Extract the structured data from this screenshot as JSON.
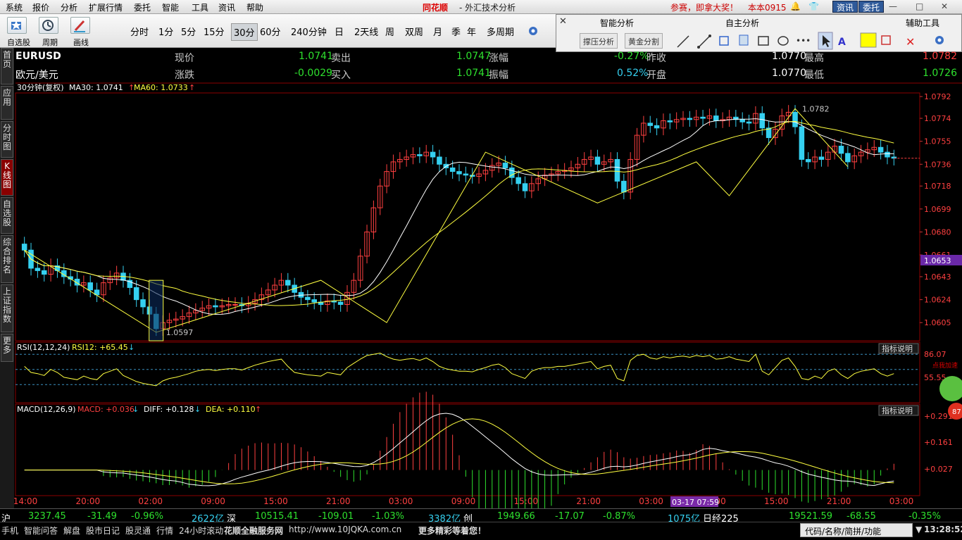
{
  "menu": [
    "系统",
    "报价",
    "分析",
    "扩展行情",
    "委托",
    "智能",
    "工具",
    "资讯",
    "帮助"
  ],
  "brand": {
    "logo": "同花顺",
    "subtitle": "- 外汇技术分析"
  },
  "promo": "参赛，即拿大奖！",
  "user": "本本0915",
  "top_buttons": {
    "news": "资讯",
    "entrust": "委托"
  },
  "toolbar": {
    "watchlist": "自选股",
    "cycle": "周期",
    "drawline": "画线"
  },
  "periods": [
    "分时",
    "1分",
    "5分",
    "15分",
    "30分",
    "60分",
    "240分钟",
    "日",
    "2天线",
    "周",
    "双周",
    "月",
    "季",
    "年",
    "多周期"
  ],
  "active_period": "30分",
  "float_panel": {
    "smart": "智能分析",
    "self": "自主分析",
    "aux": "辅助工具",
    "btn_resist": "撑压分析",
    "btn_golden": "黄金分割"
  },
  "sidebar": [
    {
      "label": "首页",
      "active": false
    },
    {
      "label": "应用",
      "active": false
    },
    {
      "label": "分时图",
      "active": false
    },
    {
      "label": "K线图",
      "active": true
    },
    {
      "label": "自选股",
      "active": false
    },
    {
      "label": "综合排名",
      "active": false
    },
    {
      "label": "上证指数",
      "active": false
    },
    {
      "label": "更多",
      "active": false
    }
  ],
  "quote": {
    "code": "EURUSD",
    "name": "欧元/美元",
    "now_label": "现价",
    "now": "1.0741",
    "sell_label": "卖出",
    "sell": "1.0747",
    "chgpct_label": "涨幅",
    "chgpct": "-0.27%",
    "prev_label": "昨收",
    "prev": "1.0770",
    "high_label": "最高",
    "high": "1.0782",
    "chg_label": "涨跌",
    "chg": "-0.0029",
    "buy_label": "买入",
    "buy": "1.0741",
    "amp_label": "振幅",
    "amp": "0.52%",
    "open_label": "开盘",
    "open": "1.0770",
    "low_label": "最低",
    "low": "1.0726"
  },
  "indicators": {
    "main": "30分钟(复权)",
    "ma30": "MA30: 1.0741",
    "ma60": "MA60: 1.0733",
    "rsi": "RSI(12,12,24)",
    "rsi12": "RSI12: +65.45",
    "macd": "MACD(12,26,9)",
    "macd_val": "MACD: +0.036",
    "diff": "DIFF: +0.128",
    "dea": "DEA: +0.110",
    "explain": "指标说明"
  },
  "annotations": {
    "high": "1.0782",
    "low": "1.0597",
    "crosshair_time": "03-17 07:59",
    "cur_price": "1.0653",
    "addspeed": "点我加速",
    "badge": "87"
  },
  "chart_data": {
    "type": "candlestick",
    "y_ticks": [
      "1.0792",
      "1.0774",
      "1.0755",
      "1.0736",
      "1.0718",
      "1.0699",
      "1.0680",
      "1.0661",
      "1.0643",
      "1.0624",
      "1.0605"
    ],
    "y_range": [
      1.059,
      1.0795
    ],
    "x_ticks": [
      "14:00",
      "20:00",
      "02:00",
      "09:00",
      "15:00",
      "21:00",
      "03:00",
      "09:00",
      "15:00",
      "21:00",
      "03:00",
      "09:00",
      "15:00",
      "21:00",
      "03:00"
    ],
    "close": [
      1.0665,
      1.065,
      1.0648,
      1.0645,
      1.0652,
      1.0648,
      1.0643,
      1.0641,
      1.0636,
      1.0638,
      1.0632,
      1.0628,
      1.0638,
      1.0642,
      1.0646,
      1.064,
      1.0634,
      1.0624,
      1.0618,
      1.0612,
      1.06,
      1.0605,
      1.0607,
      1.0608,
      1.061,
      1.0613,
      1.0615,
      1.0617,
      1.0619,
      1.0618,
      1.0619,
      1.062,
      1.062,
      1.0619,
      1.0621,
      1.0624,
      1.0628,
      1.0632,
      1.0636,
      1.064,
      1.0636,
      1.063,
      1.0626,
      1.0624,
      1.0622,
      1.062,
      1.0623,
      1.0622,
      1.062,
      1.063,
      1.064,
      1.066,
      1.068,
      1.07,
      1.0718,
      1.073,
      1.0738,
      1.074,
      1.0742,
      1.0744,
      1.0743,
      1.0746,
      1.0742,
      1.0736,
      1.0733,
      1.073,
      1.0728,
      1.0727,
      1.0726,
      1.0728,
      1.0731,
      1.0735,
      1.0737,
      1.0733,
      1.0725,
      1.072,
      1.0714,
      1.072,
      1.0724,
      1.0727,
      1.0728,
      1.073,
      1.0731,
      1.0733,
      1.0736,
      1.074,
      1.0742,
      1.0736,
      1.0738,
      1.074,
      1.0722,
      1.0713,
      1.074,
      1.076,
      1.077,
      1.0768,
      1.0766,
      1.0772,
      1.0771,
      1.0773,
      1.0774,
      1.0773,
      1.0775,
      1.0774,
      1.0776,
      1.0772,
      1.0773,
      1.0775,
      1.0773,
      1.0771,
      1.077,
      1.0778,
      1.0766,
      1.0758,
      1.0765,
      1.0776,
      1.0779,
      1.0767,
      1.074,
      1.0738,
      1.0742,
      1.074,
      1.0746,
      1.0751,
      1.0745,
      1.0738,
      1.0743,
      1.0746,
      1.0748,
      1.075,
      1.0746,
      1.0742,
      1.0741
    ],
    "rsi12": [
      60,
      50,
      48,
      45,
      55,
      50,
      42,
      40,
      38,
      44,
      40,
      38,
      48,
      52,
      56,
      45,
      40,
      35,
      32,
      30,
      28,
      36,
      40,
      42,
      45,
      48,
      52,
      54,
      55,
      53,
      55,
      56,
      56,
      54,
      58,
      62,
      65,
      68,
      70,
      72,
      60,
      50,
      48,
      46,
      45,
      44,
      50,
      48,
      46,
      58,
      65,
      72,
      78,
      80,
      82,
      76,
      72,
      70,
      72,
      73,
      70,
      74,
      68,
      60,
      56,
      54,
      52,
      52,
      51,
      55,
      58,
      62,
      64,
      58,
      48,
      44,
      40,
      52,
      56,
      58,
      58,
      60,
      60,
      62,
      64,
      66,
      68,
      56,
      60,
      62,
      40,
      36,
      70,
      78,
      80,
      74,
      72,
      76,
      74,
      76,
      77,
      75,
      78,
      76,
      78,
      72,
      73,
      76,
      72,
      70,
      68,
      80,
      52,
      46,
      58,
      70,
      74,
      60,
      40,
      38,
      44,
      40,
      52,
      56,
      46,
      40,
      48,
      52,
      54,
      56,
      48,
      44,
      48
    ]
  }
}
